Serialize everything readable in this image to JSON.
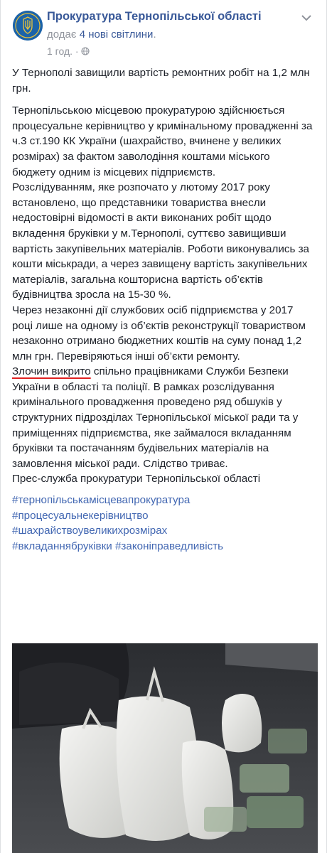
{
  "header": {
    "page_name": "Прокуратура Тернопільської області",
    "added_prefix": "додає",
    "added_link": "4 нові світлини",
    "added_suffix": ".",
    "time": "1 год.",
    "separator": "·",
    "privacy_icon": "globe-icon",
    "menu_icon": "chevron-down-icon"
  },
  "post": {
    "p1": "У Тернополі завищили вартість ремонтних робіт на 1,2 млн грн.",
    "p2": "Тернопільською місцевою прокуратурою здійснюється процесуальне керівництво у кримінальному провадженні за ч.3 ст.190 КК України (шахрайство, вчинене у великих розмірах) за фактом заволодіння коштами міського бюджету одним із місцевих підприємств.",
    "p3": "Розслідуванням, яке розпочато у лютому 2017 року встановлено, що представники товариства внесли недостовірні відомості в акти виконаних робіт щодо вкладення бруківки у м.Тернополі, суттєво завищивши вартість закупівельних матеріалів. Роботи виконувались за кошти міськради, а через завищену вартість закупівельних матеріалів, загальна кошторисна вартість об’єктів будівництва зросла на 15-30 %.",
    "p4": "Через незаконні дії службових осіб підприємства у 2017 році лише на одному із об’єктів реконструкції товариством незаконно отримано бюджетних коштів на суму понад 1,2 млн грн. Перевіряються інші об’єкти ремонту.",
    "p5_underlined": "Злочин викрито",
    "p5_rest": " спільно працівниками Служби Безпеки України в області та поліції. В рамках розслідування кримінального провадження проведено ряд обшуків у структурних підрозділах Тернопільської міської ради та у приміщеннях підприємства, яке займалося вкладанням бруківки та постачанням будівельних матеріалів на замовлення міської ради. Слідство триває.",
    "p6": "Прес-служба прокуратури Тернопільської області",
    "hashtags": [
      "#тернопільськамісцевапрокуратура",
      "#процесуальнекерівництво",
      "#шахрайствоувеликихрозмірах",
      "#вкладаннябруківки",
      "#законіправедливість"
    ]
  },
  "colors": {
    "link": "#385898",
    "hashtag": "#4267b2",
    "meta": "#90949c",
    "underline": "#e02020"
  }
}
